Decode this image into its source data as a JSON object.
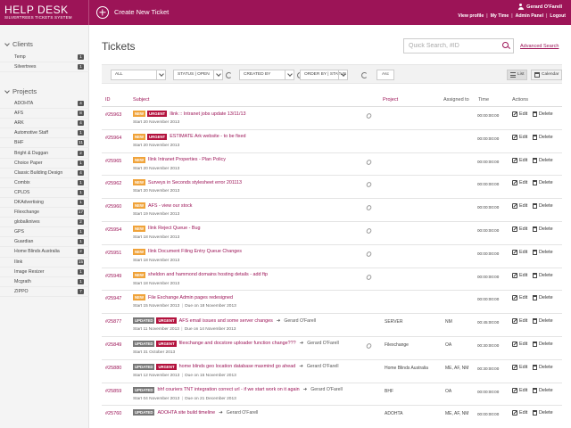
{
  "app": {
    "title": "HELP DESK",
    "subtitle": "SILVERTREES TICKETS SYSTEM",
    "new_ticket": "Create New Ticket"
  },
  "user": {
    "name": "Gerard O'Farell",
    "links": [
      "View profile",
      "My Time",
      "Admin Panel",
      "Logout"
    ]
  },
  "sidebar": {
    "clients_title": "Clients",
    "clients": [
      {
        "label": "Temp",
        "count": "1"
      },
      {
        "label": "Silvertrees",
        "count": "1"
      }
    ],
    "projects_title": "Projects",
    "projects": [
      {
        "label": "ADOHTA",
        "count": "4"
      },
      {
        "label": "AFS",
        "count": "8"
      },
      {
        "label": "ARK",
        "count": "4"
      },
      {
        "label": "Automotive Staff",
        "count": "1"
      },
      {
        "label": "BHF",
        "count": "11"
      },
      {
        "label": "Bright & Duggan",
        "count": "2"
      },
      {
        "label": "Choice Paper",
        "count": "1"
      },
      {
        "label": "Classic Building Design",
        "count": "4"
      },
      {
        "label": "Combix",
        "count": "1"
      },
      {
        "label": "CPLDS",
        "count": "1"
      },
      {
        "label": "DKAdvertising",
        "count": "1"
      },
      {
        "label": "Filexchange",
        "count": "17"
      },
      {
        "label": "globalknives",
        "count": "2"
      },
      {
        "label": "GPS",
        "count": "1"
      },
      {
        "label": "Guardian",
        "count": "1"
      },
      {
        "label": "Home Blinds Australia",
        "count": "2"
      },
      {
        "label": "Ilink",
        "count": "15"
      },
      {
        "label": "Image Resizer",
        "count": "1"
      },
      {
        "label": "Mcgrath",
        "count": "1"
      },
      {
        "label": "ZIPPO",
        "count": "7"
      }
    ]
  },
  "main": {
    "title": "Tickets",
    "search_placeholder": "Quick Search, #ID",
    "advanced_search": "Advanced Search",
    "filters": {
      "all": "ALL",
      "status": "STATUS | OPEN",
      "created_by": "CREATED BY",
      "order_by": "ORDER BY | STATUS",
      "asc": "Asc",
      "list": "List",
      "calendar": "Calendar"
    },
    "columns": {
      "id": "ID",
      "subject": "Subject",
      "project": "Project",
      "assigned": "Assigned to",
      "time": "Time",
      "actions": "Actions"
    },
    "edit_label": "Edit",
    "delete_label": "Delete"
  },
  "tickets": [
    {
      "id": "#25963",
      "badges": [
        "NEW",
        "URGENT"
      ],
      "subject": "Ilink :: Intranet jobs update 13/11/13",
      "assigned_name": "",
      "start": "Start 20 November 2013",
      "due": "",
      "attach": true,
      "project": "",
      "assigned": "",
      "time": "00:00:00:00"
    },
    {
      "id": "#25964",
      "badges": [
        "NEW",
        "URGENT"
      ],
      "subject": "ESTIMATE Ark website - to be fixed",
      "assigned_name": "",
      "start": "Start 20 November 2013",
      "due": "",
      "attach": false,
      "project": "",
      "assigned": "",
      "time": "00:00:00:00"
    },
    {
      "id": "#25965",
      "badges": [
        "NEW"
      ],
      "subject": "Ilink Intranet Properties - Plan Policy",
      "assigned_name": "",
      "start": "Start 20 November 2013",
      "due": "",
      "attach": true,
      "project": "",
      "assigned": "",
      "time": "00:00:00:00"
    },
    {
      "id": "#25962",
      "badges": [
        "NEW"
      ],
      "subject": "Surveys in Seconds stylesheet error 201113",
      "assigned_name": "",
      "start": "Start 20 November 2013",
      "due": "",
      "attach": true,
      "project": "",
      "assigned": "",
      "time": "00:00:00:00"
    },
    {
      "id": "#25960",
      "badges": [
        "NEW"
      ],
      "subject": "AFS - view our stock",
      "assigned_name": "",
      "start": "Start 19 November 2013",
      "due": "",
      "attach": true,
      "project": "",
      "assigned": "",
      "time": "00:00:00:00"
    },
    {
      "id": "#25954",
      "badges": [
        "NEW"
      ],
      "subject": "Ilink Reject Queue - Bug",
      "assigned_name": "",
      "start": "Start 18 November 2013",
      "due": "",
      "attach": true,
      "project": "",
      "assigned": "",
      "time": "00:00:00:00"
    },
    {
      "id": "#25951",
      "badges": [
        "NEW"
      ],
      "subject": "Ilink Document Filing Entry Queue Changes",
      "assigned_name": "",
      "start": "Start 18 November 2013",
      "due": "",
      "attach": true,
      "project": "",
      "assigned": "",
      "time": "00:00:00:00"
    },
    {
      "id": "#25949",
      "badges": [
        "NEW"
      ],
      "subject": "sheldon and hammond domains hosting details - add ftp",
      "assigned_name": "",
      "start": "Start 18 November 2013",
      "due": "",
      "attach": true,
      "project": "",
      "assigned": "",
      "time": "00:00:00:00"
    },
    {
      "id": "#25947",
      "badges": [
        "NEW"
      ],
      "subject": "File Exchange Admin pages redesigned",
      "assigned_name": "",
      "start": "Start 15 November 2013",
      "due": "Due on 18 November 2013",
      "attach": false,
      "project": "",
      "assigned": "",
      "time": "00:00:00:00"
    },
    {
      "id": "#25877",
      "badges": [
        "UPDATED",
        "URGENT"
      ],
      "subject": "AFS email issues and some server changes",
      "assigned_name": "Gerard O'Farell",
      "start": "Start 11 November 2013",
      "due": "Due on 14 November 2013",
      "attach": false,
      "project": "SERVER",
      "assigned": "NM",
      "time": "00:45:00:00"
    },
    {
      "id": "#25849",
      "badges": [
        "UPDATED",
        "URGENT"
      ],
      "subject": "filexchange and docstore uploader function change???",
      "assigned_name": "Gerard O'Farell",
      "start": "Start 31 October 2013",
      "due": "",
      "attach": true,
      "project": "Filexchange",
      "assigned": "OA",
      "time": "00:30:00:00"
    },
    {
      "id": "#25880",
      "badges": [
        "UPDATED",
        "URGENT"
      ],
      "subject": "home blinds geo location database maxmind go ahead",
      "assigned_name": "Gerard O'Farell",
      "start": "Start 12 November 2013",
      "due": "Due on 15 November 2013",
      "attach": false,
      "project": "Home Blinds Australia",
      "assigned": "ME, AF, NM",
      "time": "00:30:00:00"
    },
    {
      "id": "#25859",
      "badges": [
        "UPDATED"
      ],
      "subject": "bhf couriers TNT integration correct url - if we start work on it again",
      "assigned_name": "Gerard O'Farell",
      "start": "Start 04 November 2013",
      "due": "Due on 21 December 2013",
      "attach": false,
      "project": "BHF",
      "assigned": "OA",
      "time": "00:00:00:00"
    },
    {
      "id": "#25760",
      "badges": [
        "UPDATED"
      ],
      "subject": "ADOHTA site build timeline",
      "assigned_name": "Gerard O'Farell",
      "start": "",
      "due": "",
      "attach": false,
      "project": "ADOHTA",
      "assigned": "ME, AF, NM",
      "time": "00:00:00:00"
    }
  ]
}
